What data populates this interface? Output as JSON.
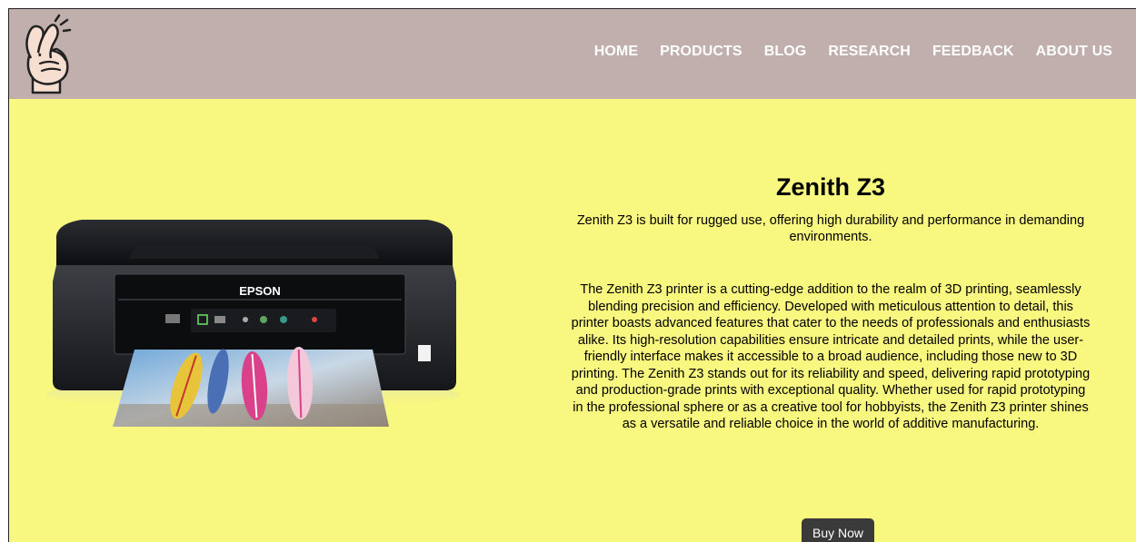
{
  "nav": {
    "items": [
      {
        "label": "HOME"
      },
      {
        "label": "PRODUCTS"
      },
      {
        "label": "BLOG"
      },
      {
        "label": "RESEARCH"
      },
      {
        "label": "FEEDBACK"
      },
      {
        "label": "ABOUT US"
      }
    ]
  },
  "logo": {
    "icon": "fingers-crossed-hand-icon"
  },
  "product": {
    "image_brand": "EPSON",
    "title": "Zenith Z3",
    "subtitle": "Zenith Z3 is built for rugged use, offering high durability and performance in demanding environments.",
    "description": "The Zenith Z3 printer is a cutting-edge addition to the realm of 3D printing, seamlessly blending precision and efficiency. Developed with meticulous attention to detail, this printer boasts advanced features that cater to the needs of professionals and enthusiasts alike. Its high-resolution capabilities ensure intricate and detailed prints, while the user-friendly interface makes it accessible to a broad audience, including those new to 3D printing. The Zenith Z3 stands out for its reliability and speed, delivering rapid prototyping and production-grade prints with exceptional quality. Whether used for rapid prototyping in the professional sphere or as a creative tool for hobbyists, the Zenith Z3 printer shines as a versatile and reliable choice in the world of additive manufacturing.",
    "buy_label": "Buy Now"
  },
  "colors": {
    "header_bg": "#c1afae",
    "page_bg": "#f8f77f",
    "nav_text": "#ffffff",
    "button_bg": "#3a3a3a"
  }
}
